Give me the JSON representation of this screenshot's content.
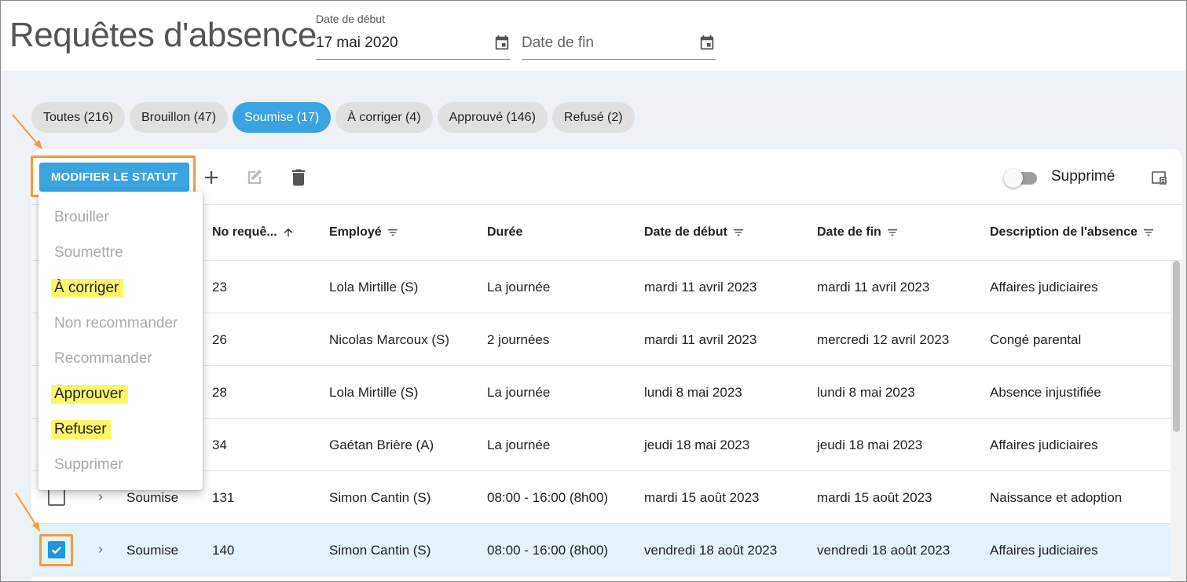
{
  "header": {
    "title": "Requêtes d'absence",
    "start_date": {
      "label": "Date de début",
      "value": "17 mai 2020"
    },
    "end_date": {
      "placeholder": "Date de fin"
    }
  },
  "chips": [
    {
      "label": "Toutes (216)"
    },
    {
      "label": "Brouillon (47)"
    },
    {
      "label": "Soumise (17)"
    },
    {
      "label": "À corriger (4)"
    },
    {
      "label": "Approuvé (146)"
    },
    {
      "label": "Refusé (2)"
    }
  ],
  "toolbar": {
    "status_button": "MODIFIER LE STATUT",
    "deleted_toggle_label": "Supprimé"
  },
  "menu": {
    "items": [
      {
        "label": "Brouiller"
      },
      {
        "label": "Soumettre"
      },
      {
        "label": "À corriger"
      },
      {
        "label": "Non recommander"
      },
      {
        "label": "Recommander"
      },
      {
        "label": "Approuver"
      },
      {
        "label": "Refuser"
      },
      {
        "label": "Supprimer"
      }
    ]
  },
  "table": {
    "columns": {
      "number": "No requê...",
      "employee": "Employé",
      "duration": "Durée",
      "start": "Date de début",
      "end": "Date de fin",
      "description": "Description de l'absence"
    },
    "rows": [
      {
        "status": "",
        "number": "23",
        "employee": "Lola Mirtille (S)",
        "duration": "La journée",
        "start": "mardi 11 avril 2023",
        "end": "mardi 11 avril 2023",
        "description": "Affaires judiciaires"
      },
      {
        "status": "",
        "number": "26",
        "employee": "Nicolas Marcoux (S)",
        "duration": "2 journées",
        "start": "mardi 11 avril 2023",
        "end": "mercredi 12 avril 2023",
        "description": "Congé parental"
      },
      {
        "status": "",
        "number": "28",
        "employee": "Lola Mirtille (S)",
        "duration": "La journée",
        "start": "lundi 8 mai 2023",
        "end": "lundi 8 mai 2023",
        "description": "Absence injustifiée"
      },
      {
        "status": "",
        "number": "34",
        "employee": "Gaétan Brière (A)",
        "duration": "La journée",
        "start": "jeudi 18 mai 2023",
        "end": "jeudi 18 mai 2023",
        "description": "Affaires judiciaires"
      },
      {
        "status": "Soumise",
        "number": "131",
        "employee": "Simon Cantin (S)",
        "duration": "08:00 - 16:00 (8h00)",
        "start": "mardi 15 août 2023",
        "end": "mardi 15 août 2023",
        "description": "Naissance et adoption"
      },
      {
        "status": "Soumise",
        "number": "140",
        "employee": "Simon Cantin (S)",
        "duration": "08:00 - 16:00 (8h00)",
        "start": "vendredi 18 août 2023",
        "end": "vendredi 18 août 2023",
        "description": "Affaires judiciaires"
      }
    ]
  },
  "colors": {
    "accent": "#3aa3e0",
    "highlight_box": "#f39c3a",
    "menu_highlight": "#fbf76b",
    "selected_row": "#e3f2fb"
  }
}
